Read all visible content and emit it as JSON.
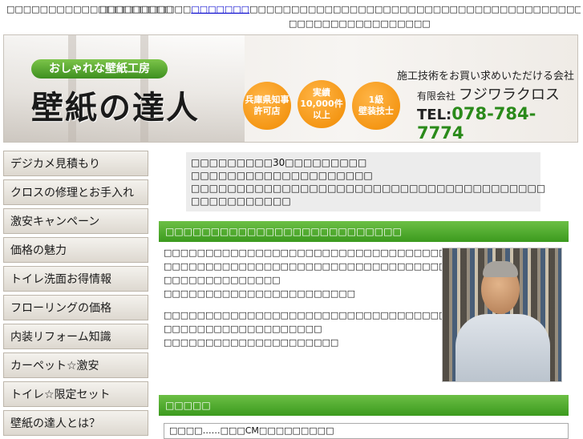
{
  "topbar": {
    "left": "□□□□□□□□□□□□□□□□□□□□",
    "right_prefix": "□□□□□□□□□□□",
    "right_link": "□□□□□□□",
    "right_suffix": "□□□□□□□□□□□□□□□□□□□□□□□□□□□□□□□□□□□□□□□□□□□□□□□□□□□□□□□□□□□□□□□□□□□□□□□□□□□□□",
    "sub": "□□□□□□□□□□□□□□□□□"
  },
  "header": {
    "tagline": "おしゃれな壁紙工房",
    "logo": "壁紙の達人",
    "badges": [
      "兵庫県知事\n許可店",
      "実績\n10,000件\n以上",
      "1級\n壁装技士"
    ],
    "company_line1": "施工技術をお買い求めいただける会社",
    "company_prefix": "有限会社",
    "company_name": "フジワラクロス",
    "tel_label": "TEL:",
    "tel_number": "078-784-7774"
  },
  "nav": {
    "items": [
      "デジカメ見積もり",
      "クロスの修理とお手入れ",
      "激安キャンペーン",
      "価格の魅力",
      "トイレ洗面お得情報",
      "フローリングの価格",
      "内装リフォーム知識",
      "カーペット☆激安",
      "トイレ☆限定セット",
      "壁紙の達人とは？"
    ]
  },
  "intro": {
    "lines": [
      "□□□□□□□□□30□□□□□□□□□",
      "□□□□□□□□□□□□□□□□□□□□",
      "□□□□□□□□□□□□□□□□□□□□□□□□□□□□□□□□□□□□□□□",
      "□□□□□□□□□□□"
    ]
  },
  "section1": {
    "title": "□□□□□□□□□□□□□□□□□□□□□□□□□□",
    "para1": [
      "□□□□□□□□□□□□□□□□□□□□□□□□□□□□□□□□□□□□□",
      "□□□□□□□□□□□□□□□□□□□□□□□□□□□□□□□□□□□□□□□□□□□□□",
      "□□□□□□□□□□□□□□",
      "□□□□□□□□□□□□□□□□□□□□□□□"
    ],
    "para2": [
      "□□□□□□□□□□□□□□□□□□□□□□□□□□□□□□□□□□□□□□□□□",
      "□□□□□□□□□□□□□□□□□□□",
      "□□□□□□□□□□□□□□□□□□□□□"
    ]
  },
  "section2": {
    "title": "□□□□□",
    "news": "□□□□……□□□CM□□□□□□□□□"
  }
}
